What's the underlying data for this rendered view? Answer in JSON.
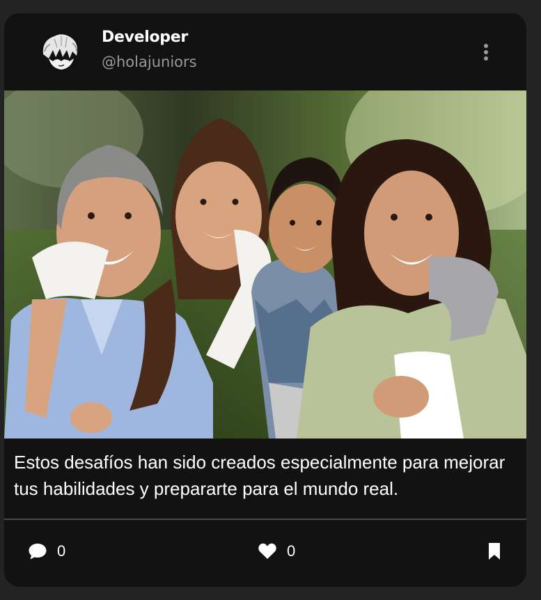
{
  "post": {
    "author": {
      "name": "Developer",
      "handle": "@holajuniors",
      "avatar_icon": "anime-avatar"
    },
    "menu_icon": "more-vertical-icon",
    "image_description_icon": "family-photo",
    "caption": "Estos desafíos han sido creados especialmente para mejorar tus habilidades y prepararte para el mundo real.",
    "actions": {
      "comments": {
        "icon": "comment-icon",
        "count": "0"
      },
      "likes": {
        "icon": "heart-icon",
        "count": "0"
      },
      "bookmark": {
        "icon": "bookmark-icon"
      }
    }
  },
  "colors": {
    "page_bg": "#232323",
    "card_bg": "#121212",
    "text": "#ffffff",
    "muted": "#9a9a9a",
    "divider": "#4a4a4a"
  }
}
